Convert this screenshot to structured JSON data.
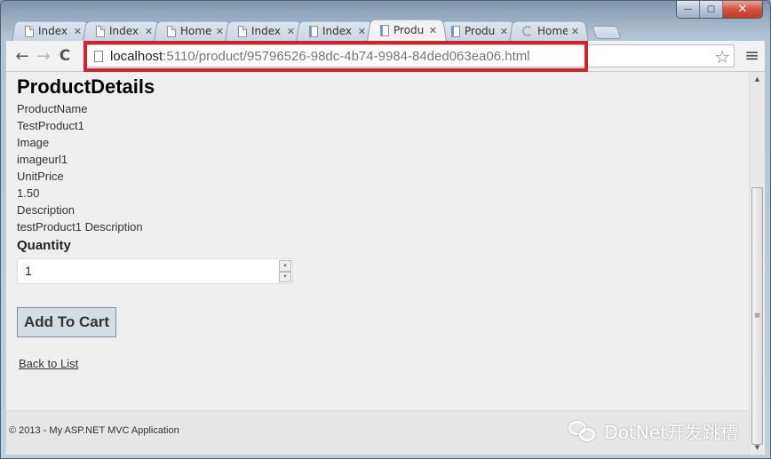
{
  "window": {
    "controls": {
      "minimize": "—",
      "maximize": "▢",
      "close": "✕"
    }
  },
  "tabs": [
    {
      "title": "Index",
      "icon": "page-icon",
      "active": false
    },
    {
      "title": "Index",
      "icon": "page-icon",
      "active": false
    },
    {
      "title": "Home",
      "icon": "page-icon",
      "active": false
    },
    {
      "title": "Index",
      "icon": "page-icon",
      "active": false
    },
    {
      "title": "Index",
      "icon": "app-page-icon",
      "active": false
    },
    {
      "title": "Produ",
      "icon": "app-page-icon",
      "active": true
    },
    {
      "title": "Produ",
      "icon": "app-page-icon",
      "active": false
    },
    {
      "title": "Home",
      "icon": "loading-spinner-icon",
      "active": false
    }
  ],
  "toolbar": {
    "back": "←",
    "forward": "→",
    "reload": "C",
    "url_host": "localhost",
    "url_rest": ":5110/product/95796526-98dc-4b74-9984-84ded063ea06.html",
    "star": "☆",
    "menu": "≡"
  },
  "page": {
    "heading": "ProductDetails",
    "fields": [
      {
        "label": "ProductName",
        "value": "TestProduct1"
      },
      {
        "label": "Image",
        "value": "imageurl1"
      },
      {
        "label": "UnitPrice",
        "value": "1.50"
      },
      {
        "label": "Description",
        "value": "testProduct1 Description"
      }
    ],
    "quantity_label": "Quantity",
    "quantity_value": "1",
    "add_to_cart": "Add To Cart",
    "back_link": "Back to List",
    "footer": "© 2013 - My ASP.NET MVC Application"
  },
  "watermark": "DotNet开发跳槽",
  "scrollbar": {
    "up": "▲",
    "down": "▼",
    "grip": "≡"
  }
}
